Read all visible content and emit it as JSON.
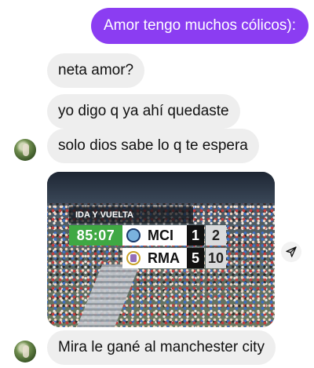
{
  "messages": {
    "outgoing_1": "Amor tengo muchos cólicos):",
    "incoming_1": "neta amor?",
    "incoming_2": "yo digo q ya ahí quedaste",
    "incoming_3": "solo dios sabe lo q te espera",
    "incoming_4": "Mira le gané al manchester city"
  },
  "photo": {
    "scoreboard": {
      "header": "IDA Y VUELTA",
      "clock": "85:07",
      "home": {
        "code": "MCI",
        "score": "1",
        "aggregate": "2"
      },
      "away": {
        "code": "RMA",
        "score": "5",
        "aggregate": "10"
      }
    }
  },
  "colors": {
    "outgoing_bubble": "#8b3df2",
    "incoming_bubble": "#eeeeee",
    "clock_bg": "#3fa843"
  },
  "icons": {
    "share": "send-arrow-icon"
  }
}
